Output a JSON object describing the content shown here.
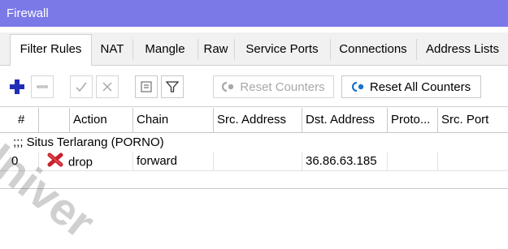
{
  "window": {
    "title": "Firewall"
  },
  "tabs": [
    {
      "label": "Filter Rules",
      "active": true
    },
    {
      "label": "NAT",
      "active": false
    },
    {
      "label": "Mangle",
      "active": false
    },
    {
      "label": "Raw",
      "active": false
    },
    {
      "label": "Service Ports",
      "active": false
    },
    {
      "label": "Connections",
      "active": false
    },
    {
      "label": "Address Lists",
      "active": false
    }
  ],
  "toolbar": {
    "add_icon": "plus-icon",
    "remove_icon": "minus-icon",
    "enable_icon": "check-icon",
    "disable_icon": "cross-icon",
    "comment_icon": "note-icon",
    "filter_icon": "filter-icon",
    "reset_counters_label": "Reset Counters",
    "reset_all_counters_label": "Reset All Counters"
  },
  "table": {
    "columns": [
      "#",
      "Action",
      "Chain",
      "Src. Address",
      "Dst. Address",
      "Proto...",
      "Src. Port"
    ],
    "comment": ";;; Situs Terlarang (PORNO)",
    "rows": [
      {
        "num": "0",
        "action": "drop",
        "chain": "forward",
        "src_address": "",
        "dst_address": "36.86.63.185",
        "proto": "",
        "src_port": ""
      }
    ]
  },
  "watermark": "Univer",
  "colors": {
    "titlebar": "#7b78e8",
    "add": "#1f2db8",
    "drop": "#c8202a",
    "reset": "#1a73c8"
  }
}
